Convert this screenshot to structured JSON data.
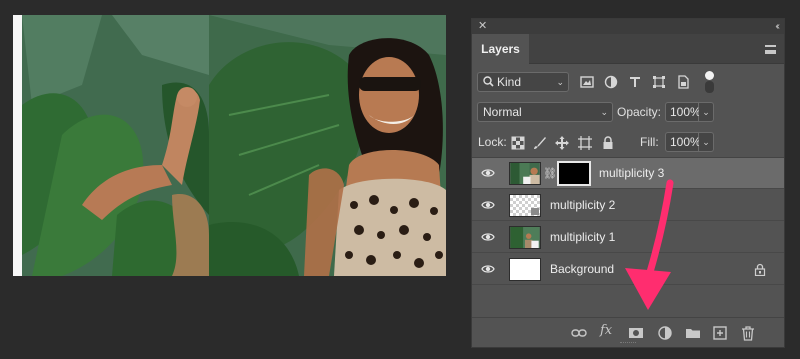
{
  "panel": {
    "tab_label": "Layers",
    "filter": {
      "label": "Kind"
    },
    "blend_mode": "Normal",
    "opacity": {
      "label": "Opacity:",
      "value": "100%"
    },
    "lock": {
      "label": "Lock:"
    },
    "fill": {
      "label": "Fill:",
      "value": "100%"
    }
  },
  "layers": [
    {
      "name": "multiplicity 3",
      "selected": true,
      "has_mask": true
    },
    {
      "name": "multiplicity 2",
      "selected": false,
      "has_mask": false
    },
    {
      "name": "multiplicity 1",
      "selected": false,
      "has_mask": false
    },
    {
      "name": "Background",
      "selected": false,
      "locked": true
    }
  ],
  "bottom_icons": [
    "link-layers-icon",
    "fx-icon",
    "add-mask-icon",
    "adjustment-layer-icon",
    "new-group-icon",
    "new-layer-icon",
    "trash-icon"
  ],
  "colors": {
    "panel_bg": "#535353",
    "selected_row": "#6b6b6b",
    "arrow": "#ff2d6f"
  }
}
